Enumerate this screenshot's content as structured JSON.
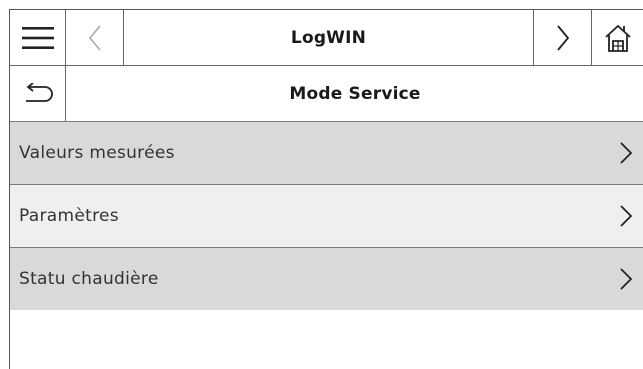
{
  "header": {
    "title": "LogWIN",
    "menu_icon": "hamburger-menu-icon",
    "prev_icon": "chevron-left-icon",
    "next_icon": "chevron-right-icon",
    "home_icon": "home-icon"
  },
  "subheader": {
    "title": "Mode Service",
    "back_icon": "back-arrow-icon"
  },
  "menu": {
    "items": [
      {
        "label": "Valeurs mesurées"
      },
      {
        "label": "Paramètres"
      },
      {
        "label": "Statu chaudière"
      }
    ]
  },
  "colors": {
    "row_grey": "#d9d9d9",
    "row_light": "#efefef",
    "border": "#666666"
  }
}
